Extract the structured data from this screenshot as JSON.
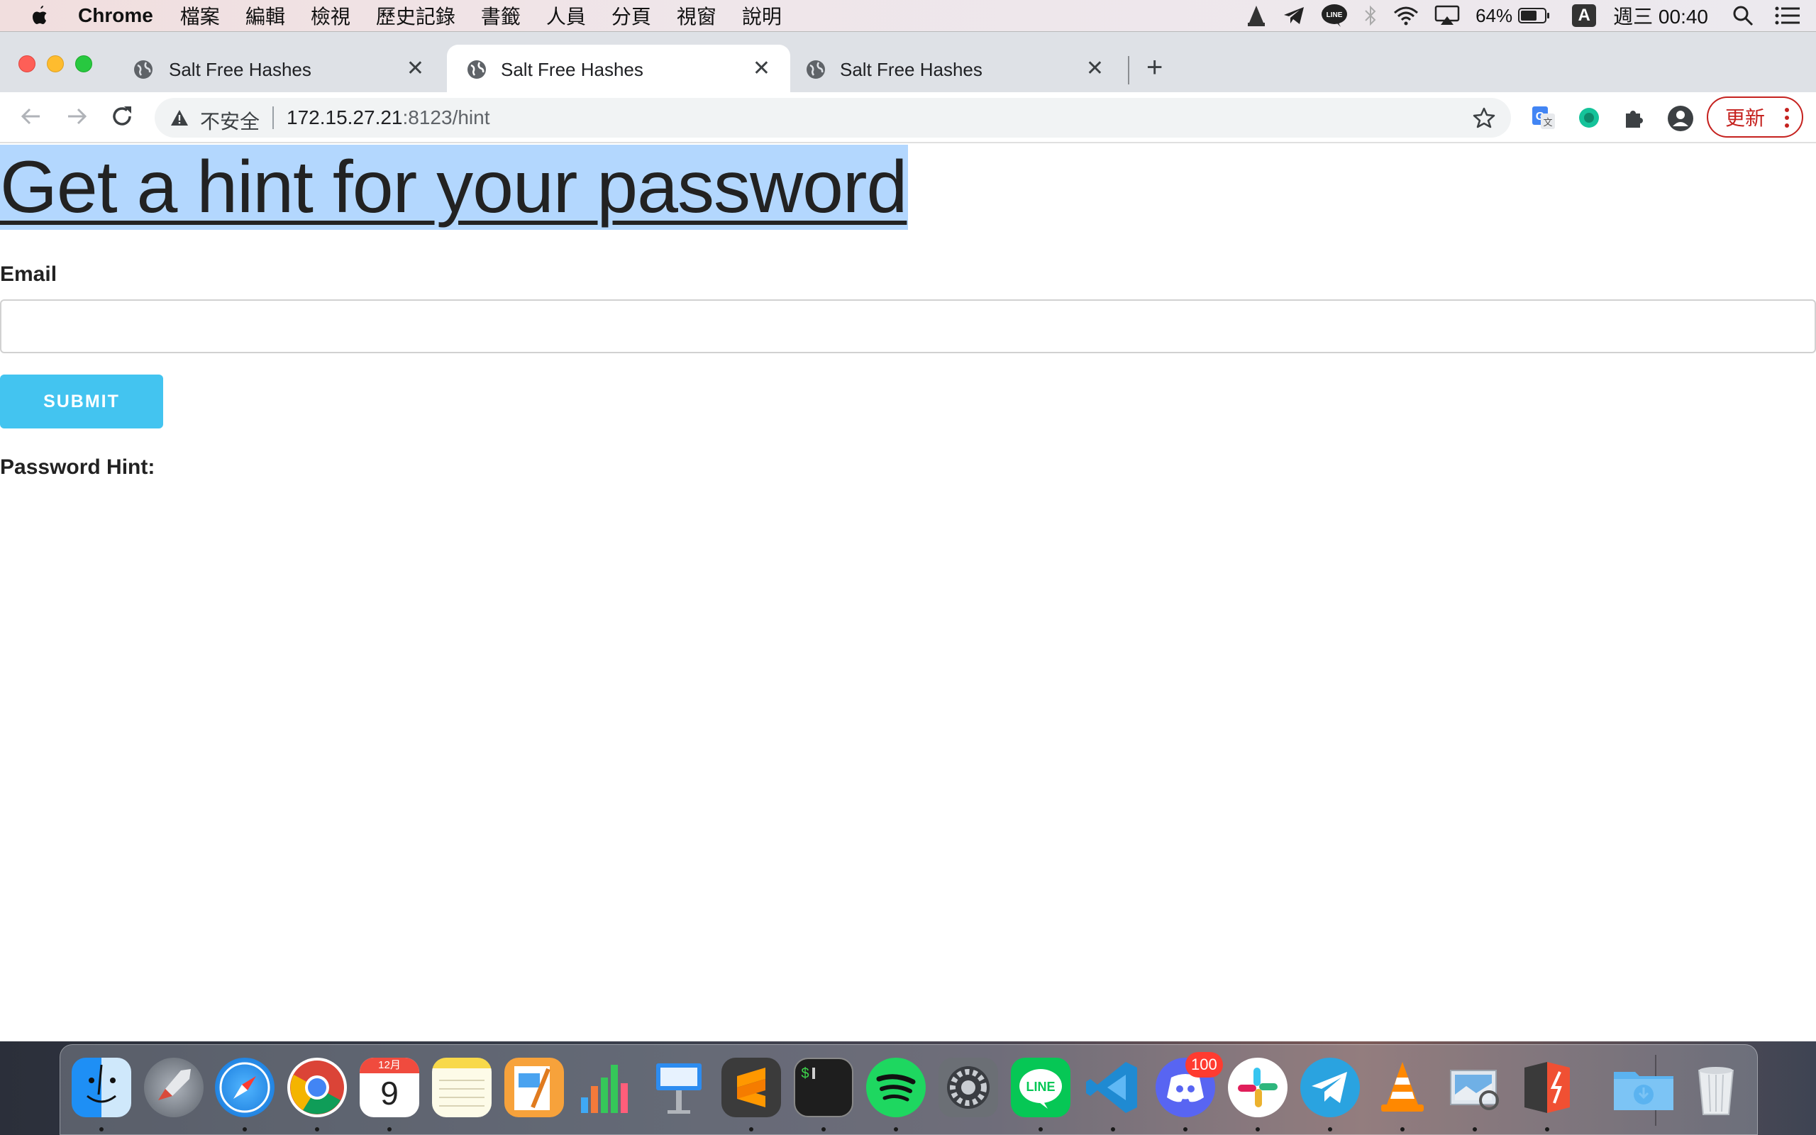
{
  "menubar": {
    "app_name": "Chrome",
    "menus": [
      "檔案",
      "編輯",
      "檢視",
      "歷史記錄",
      "書籤",
      "人員",
      "分頁",
      "視窗",
      "說明"
    ],
    "battery": "64%",
    "input_source": "A",
    "clock": "週三 00:40",
    "status_icons": [
      "vlc-icon",
      "telegram-icon",
      "line-icon",
      "bluetooth-icon",
      "wifi-icon",
      "airplay-icon",
      "battery-icon",
      "input-source-icon",
      "spotlight-search-icon",
      "notification-center-icon"
    ]
  },
  "tabs": [
    {
      "title": "Salt Free Hashes",
      "active": false
    },
    {
      "title": "Salt Free Hashes",
      "active": true
    },
    {
      "title": "Salt Free Hashes",
      "active": false
    }
  ],
  "toolbar": {
    "security_label": "不安全",
    "url_host": "172.15.27.21",
    "url_rest": ":8123/hint",
    "update_label": "更新"
  },
  "page": {
    "heading": "Get a hint for your password",
    "email_label": "Email",
    "email_value": "",
    "submit_label": "SUBMIT",
    "hint_label": "Password Hint:"
  },
  "dock": {
    "apps": [
      "finder",
      "launchpad",
      "safari",
      "chrome",
      "calendar",
      "notes",
      "pages",
      "numbers",
      "keynote",
      "sublime-text",
      "terminal",
      "spotify",
      "system-preferences",
      "line",
      "vscode",
      "discord",
      "slack",
      "telegram",
      "vlc",
      "preview",
      "git-tool",
      "downloads",
      "trash"
    ],
    "calendar_month": "12月",
    "calendar_day": "9",
    "discord_badge": "100"
  },
  "colors": {
    "accent_submit": "#43c4f0",
    "selection": "#b3d7fe",
    "update_red": "#c5221f"
  }
}
